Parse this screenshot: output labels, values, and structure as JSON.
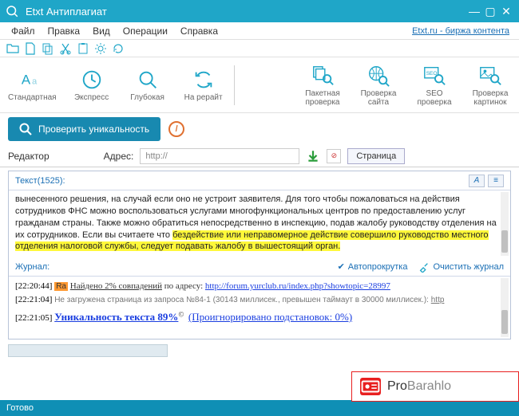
{
  "window": {
    "title": "Etxt Антиплагиат"
  },
  "menu": {
    "file": "Файл",
    "edit": "Правка",
    "view": "Вид",
    "ops": "Операции",
    "help": "Справка",
    "right_link": "Etxt.ru - биржа контента"
  },
  "ribbon": {
    "standard": "Стандартная",
    "express": "Экспресс",
    "deep": "Глубокая",
    "rewrite": "На рерайт",
    "batch": "Пакетная\nпроверка",
    "site": "Проверка\nсайта",
    "seo": "SEO\nпроверка",
    "images": "Проверка\nкартинок"
  },
  "actions": {
    "check_unique": "Проверить уникальность"
  },
  "editorbar": {
    "editor": "Редактор",
    "address": "Адрес:",
    "http_value": "http://",
    "page": "Страница"
  },
  "textpanel": {
    "header": "Текст(1525):",
    "body_pre": "вынесенного решения, на случай если оно не устроит заявителя.\nДля того чтобы пожаловаться на действия сотрудников ФНС можно воспользоваться услугами многофункциональных центров по предоставлению услуг гражданам страны. Также можно обратиться непосредственно в инспекцию, подав жалобу руководству отделения на их сотрудников. Если вы считаете что ",
    "body_hl": "бездействие или неправомерное действие совершило руководство местного отделения налоговой службы, следует подавать жалобу в вышестоящий орган.",
    "body_post": ""
  },
  "journal": {
    "header": "Журнал:",
    "autoscroll": "Автопрокрутка",
    "clear": "Очистить журнал",
    "entries": [
      {
        "ts": "[22:20:44]",
        "ra": "Ra",
        "found_pct": "Найдено 2% совпадений",
        "addr_label": " по адресу: ",
        "url": "http://forum.yurclub.ru/index.php?showtopic=28997"
      },
      {
        "ts": "[22:21:04]",
        "gray": "Не загружена страница из запроса №84-1 (30143 миллисек., превышен таймаут в 30000 миллисек.): ",
        "url_short": "http"
      },
      {
        "ts": "[22:21:05]",
        "unique": "Уникальность текста 89%",
        "copyright": "©",
        "ignored": "(Проигнорировано подстановок: 0%)"
      }
    ]
  },
  "statusbar": {
    "ready": "Готово"
  },
  "watermark": {
    "text": "ProBarahlo"
  }
}
